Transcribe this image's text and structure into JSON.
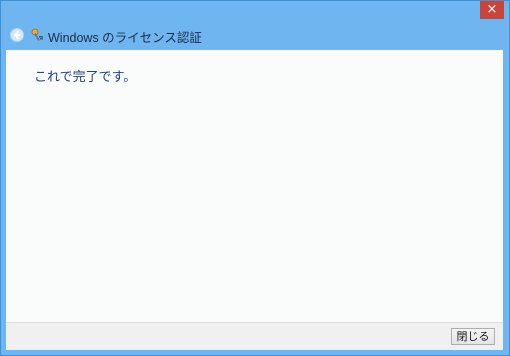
{
  "window": {
    "title": "Windows のライセンス認証",
    "close_symbol": "×"
  },
  "icons": {
    "back": "back-arrow-icon",
    "app": "license-key-icon",
    "close": "close-icon"
  },
  "main": {
    "message": "これで完了です。"
  },
  "footer": {
    "close_label": "閉じる"
  },
  "colors": {
    "frame": "#6fb5f0",
    "close_button": "#c7453b",
    "message_text": "#1d3e8a",
    "content_bg": "#f9fcfb"
  }
}
